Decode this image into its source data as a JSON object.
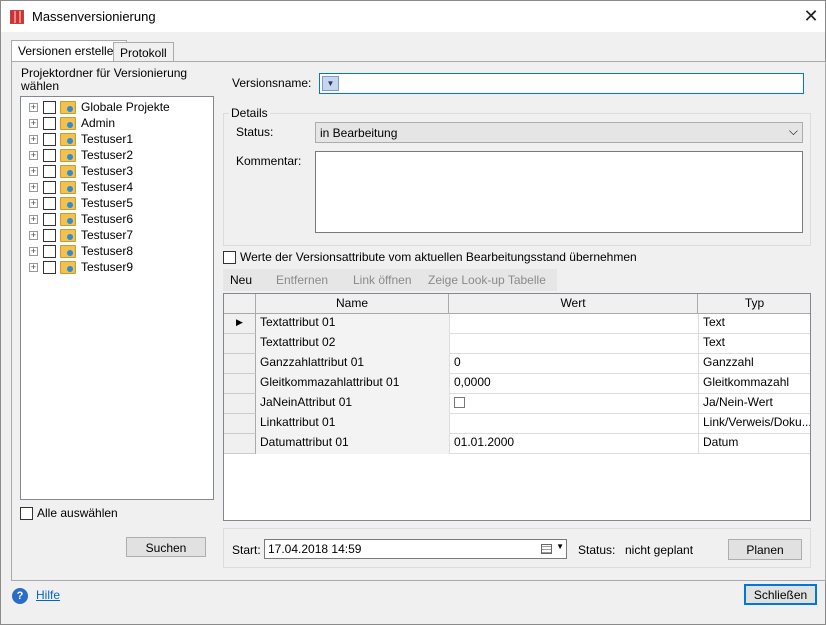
{
  "window": {
    "title": "Massenversionierung",
    "close_glyph": "✕"
  },
  "tabs": [
    {
      "label": "Versionen erstellen"
    },
    {
      "label": "Protokoll"
    }
  ],
  "left": {
    "header": "Projektordner für Versionierung wählen",
    "tree": [
      "Globale Projekte",
      "Admin",
      "Testuser1",
      "Testuser2",
      "Testuser3",
      "Testuser4",
      "Testuser5",
      "Testuser6",
      "Testuser7",
      "Testuser8",
      "Testuser9"
    ],
    "select_all": "Alle auswählen",
    "search_button": "Suchen"
  },
  "form": {
    "version_name_label": "Versionsname:",
    "version_name_value": "",
    "details_label": "Details",
    "status_label": "Status:",
    "status_value": "in Bearbeitung",
    "comment_label": "Kommentar:",
    "comment_value": "",
    "adopt_attrs_label": "Werte der Versionsattribute vom aktuellen Bearbeitungsstand übernehmen"
  },
  "toolbar": {
    "new": "Neu",
    "remove": "Entfernen",
    "open_link": "Link öffnen",
    "lookup": "Zeige Look-up Tabelle"
  },
  "grid": {
    "columns": [
      "Name",
      "Wert",
      "Typ"
    ],
    "rows": [
      {
        "name": "Textattribut 01",
        "value": "",
        "type": "Text"
      },
      {
        "name": "Textattribut 02",
        "value": "",
        "type": "Text"
      },
      {
        "name": "Ganzzahlattribut 01",
        "value": "0",
        "type": "Ganzzahl"
      },
      {
        "name": "Gleitkommazahlattribut 01",
        "value": "0,0000",
        "type": "Gleitkommazahl"
      },
      {
        "name": "JaNeinAttribut 01",
        "value": "",
        "type": "Ja/Nein-Wert"
      },
      {
        "name": "Linkattribut 01",
        "value": "",
        "type": "Link/Verweis/Doku..."
      },
      {
        "name": "Datumattribut 01",
        "value": "01.01.2000",
        "type": "Datum"
      }
    ]
  },
  "schedule": {
    "start_label": "Start:",
    "start_value": "17.04.2018 14:59",
    "status_label": "Status:",
    "status_value": "nicht geplant",
    "plan_button": "Planen"
  },
  "footer": {
    "help_link": "Hilfe",
    "close_button": "Schließen"
  },
  "colors": {
    "accent": "#0066cc",
    "focus_border": "#0078d7"
  }
}
